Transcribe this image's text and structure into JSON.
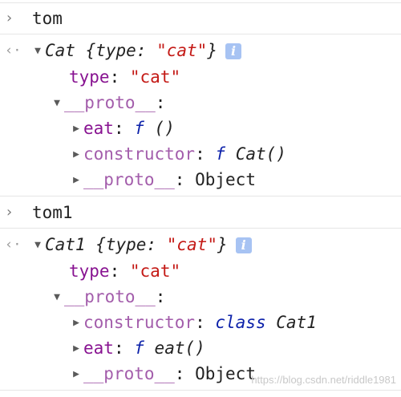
{
  "console": {
    "entries": [
      {
        "input": "tom",
        "summary": {
          "class": "Cat",
          "open": " {",
          "key": "type",
          "colon": ": ",
          "value": "\"cat\"",
          "close": "}"
        },
        "info_icon": "info-icon",
        "props": [
          {
            "key": "type",
            "value": "\"cat\""
          }
        ],
        "proto_key": "__proto__",
        "proto_items": [
          {
            "key": "eat",
            "fn": "f",
            "rest": " ()"
          },
          {
            "key": "constructor",
            "fn": "f",
            "rest": " Cat()"
          },
          {
            "key": "__proto__",
            "value": "Object"
          }
        ]
      },
      {
        "input": "tom1",
        "summary": {
          "class": "Cat1",
          "open": " {",
          "key": "type",
          "colon": ": ",
          "value": "\"cat\"",
          "close": "}"
        },
        "info_icon": "info-icon",
        "props": [
          {
            "key": "type",
            "value": "\"cat\""
          }
        ],
        "proto_key": "__proto__",
        "proto_items": [
          {
            "key": "constructor",
            "fn": "class",
            "rest": " Cat1"
          },
          {
            "key": "eat",
            "fn": "f",
            "rest": " eat()"
          },
          {
            "key": "__proto__",
            "value": "Object"
          }
        ]
      }
    ],
    "symbols": {
      "prompt": "›",
      "return": "‹·",
      "expanded": "▼",
      "collapsed": "▶",
      "info": "i",
      "colon": ":"
    },
    "colors": {
      "key": "#881391",
      "string": "#c41a16",
      "keyword": "#0d22aa",
      "divider": "#e6e6e6"
    }
  },
  "watermark": "https://blog.csdn.net/riddle1981"
}
